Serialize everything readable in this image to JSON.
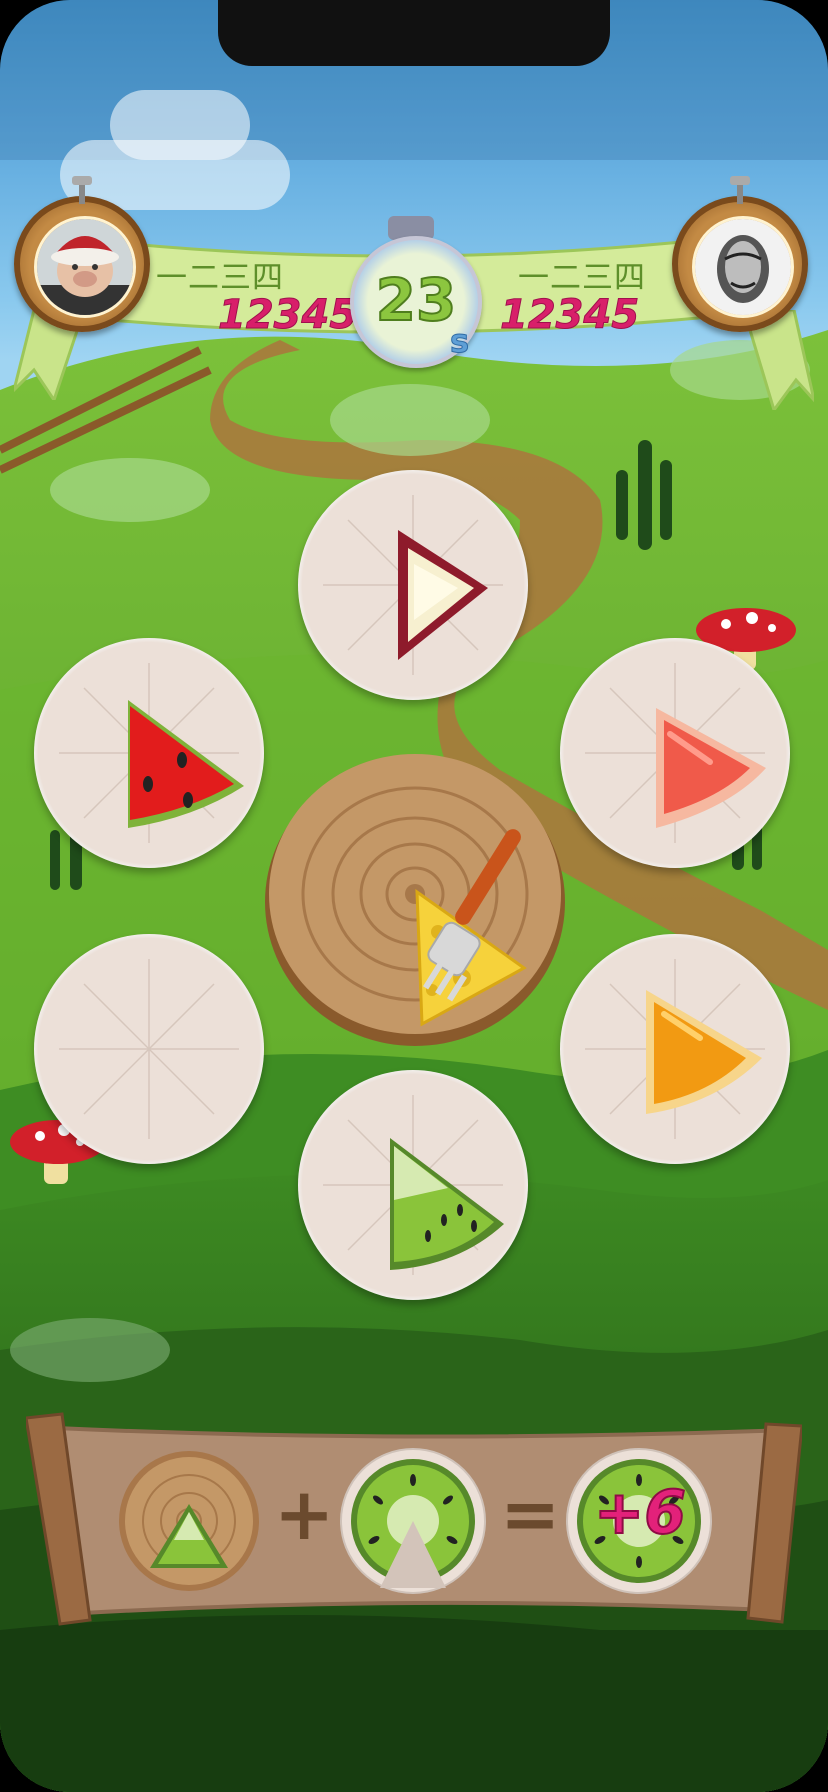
{
  "hud": {
    "player_left": {
      "name": "一二三四",
      "score": "12345"
    },
    "player_right": {
      "name": "一二三四",
      "score": "12345"
    },
    "timer": {
      "value": "23",
      "unit": "s"
    }
  },
  "board": {
    "center_piece": "cheese-slice",
    "plates": [
      {
        "id": "top",
        "fruit": "apple"
      },
      {
        "id": "upper-left",
        "fruit": "watermelon"
      },
      {
        "id": "upper-right",
        "fruit": "grapefruit"
      },
      {
        "id": "lower-left",
        "fruit": "empty"
      },
      {
        "id": "lower-right",
        "fruit": "orange"
      },
      {
        "id": "bottom",
        "fruit": "kiwi"
      }
    ]
  },
  "formula": {
    "plus": "+",
    "equals": "=",
    "result": "+6"
  },
  "colors": {
    "score_pink": "#d81f6a",
    "name_green": "#5e8f2a",
    "timer_green": "#8cc63f",
    "timer_blue": "#5f9fd6",
    "grass": "#5aa527",
    "wood": "#b08d72"
  }
}
